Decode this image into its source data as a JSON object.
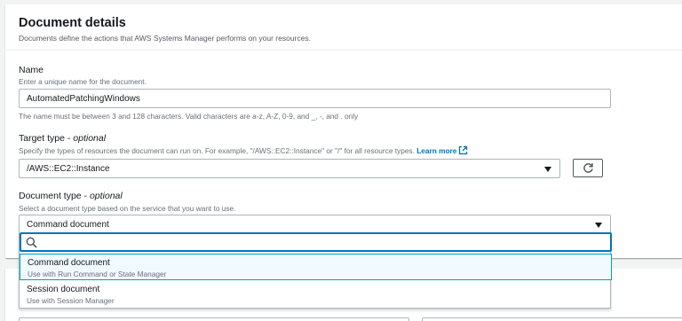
{
  "panel": {
    "title": "Document details",
    "description": "Documents define the actions that AWS Systems Manager performs on your resources."
  },
  "name_field": {
    "label": "Name",
    "hint": "Enter a unique name for the document.",
    "value": "AutomatedPatchingWindows",
    "constraint": "The name must be between 3 and 128 characters. Valid characters are a-z, A-Z, 0-9, and _, -, and . only"
  },
  "target_type": {
    "label": "Target type - ",
    "optional": "optional",
    "hint": "Specify the types of resources the document can run on. For example, \"/AWS::EC2::Instance\" or \"/\" for all resource types.",
    "learn_more": "Learn more",
    "value": "/AWS::EC2::Instance",
    "refresh_icon": "refresh-icon"
  },
  "document_type": {
    "label": "Document type - ",
    "optional": "optional",
    "hint": "Select a document type based on the service that you want to use.",
    "value": "Command document",
    "search_placeholder": "",
    "options": [
      {
        "label": "Command document",
        "description": "Use with Run Command or State Manager"
      },
      {
        "label": "Session document",
        "description": "Use with Session Manager"
      }
    ]
  },
  "colors": {
    "link": "#0073bb",
    "focus": "#00a1c9",
    "highlight_bg": "#f1faff"
  }
}
